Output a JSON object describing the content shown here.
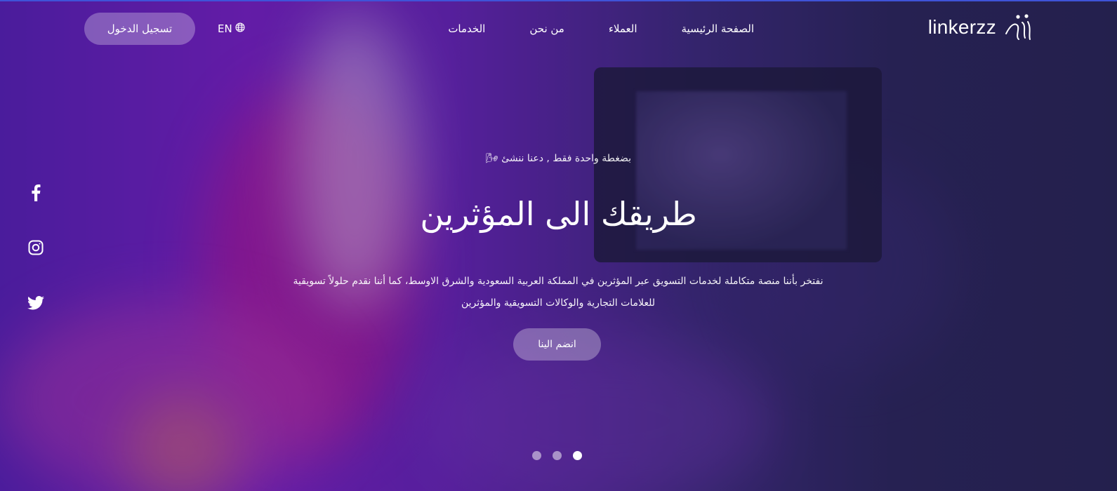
{
  "brand": {
    "name": "linkerzz",
    "icon": "linkerzz-logo-mark"
  },
  "nav": {
    "items": [
      {
        "label": "الصفحة الرئيسية"
      },
      {
        "label": "العملاء"
      },
      {
        "label": "من نحن"
      },
      {
        "label": "الخدمات"
      }
    ]
  },
  "language": {
    "label": "EN",
    "icon": "globe-icon"
  },
  "login": {
    "label": "تسجيل الدخول"
  },
  "social": [
    {
      "icon": "facebook-icon"
    },
    {
      "icon": "instagram-icon"
    },
    {
      "icon": "twitter-icon"
    }
  ],
  "hero": {
    "tagline": "بضغطة واحدة فقط , دعنا ننشئ 🌬",
    "title": "طريقك الى المؤثرين",
    "description": "نفتخر بأننا منصة متكاملة لخدمات التسويق عبر المؤثرين في المملكة العربية السعودية والشرق الاوسط، كما أننا نقدم حلولاً تسويقية للعلامات التجارية والوكالات التسويقية والمؤثرين",
    "cta": "انضم الينا"
  },
  "carousel": {
    "count": 3,
    "active": 3
  },
  "colors": {
    "accent_line": "#3f53d8",
    "background_dark": "#27254f",
    "background_purple": "#7b1fc7"
  }
}
